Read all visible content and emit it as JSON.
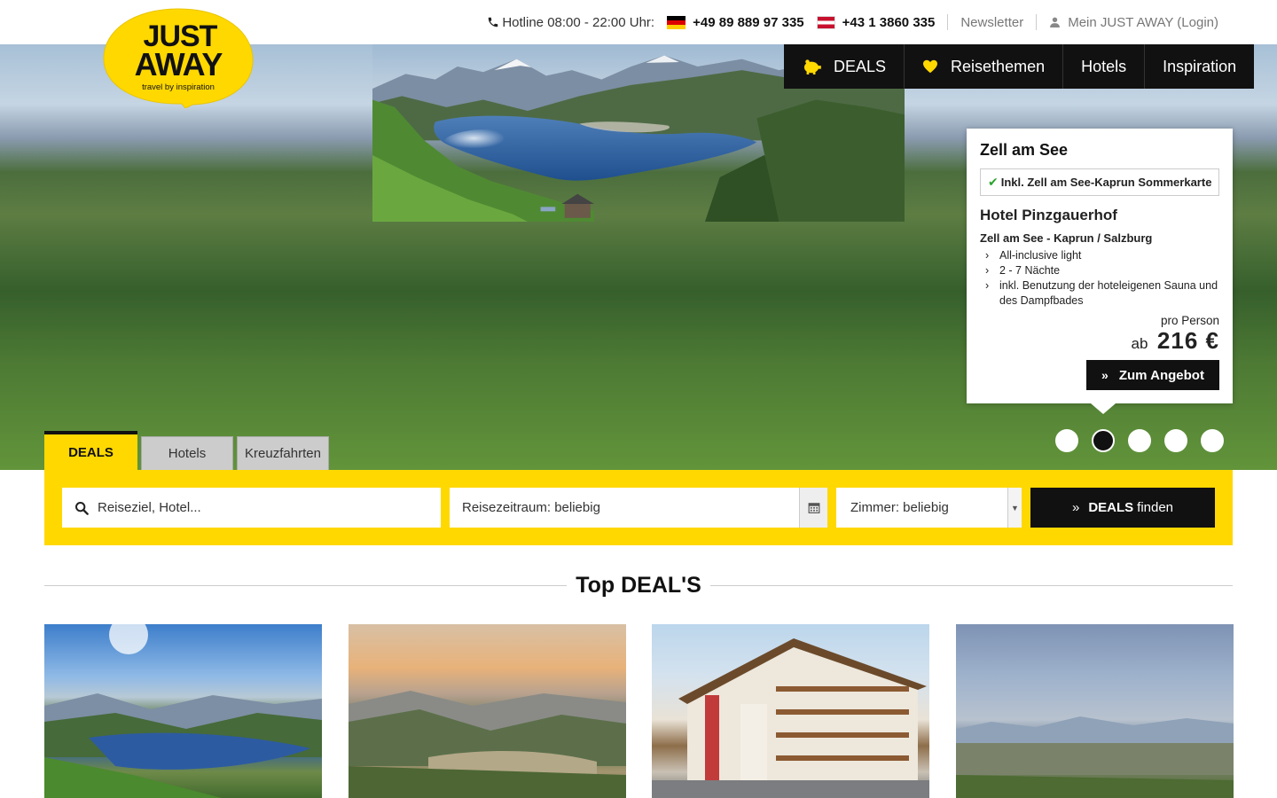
{
  "topbar": {
    "hotline_label": "Hotline 08:00 - 22:00 Uhr:",
    "phone_de": "+49 89 889 97 335",
    "phone_at": "+43 1 3860 335",
    "newsletter": "Newsletter",
    "login": "Mein JUST AWAY (Login)"
  },
  "logo": {
    "line1": "JUST",
    "line2": "AWAY",
    "tagline": "travel by inspiration"
  },
  "nav": [
    {
      "label": "DEALS",
      "icon": "piggy-bank-icon"
    },
    {
      "label": "Reisethemen",
      "icon": "heart-icon"
    },
    {
      "label": "Hotels"
    },
    {
      "label": "Inspiration"
    }
  ],
  "offer": {
    "title": "Zell am See",
    "badge": "Inkl. Zell am See-Kaprun Sommerkarte",
    "hotel": "Hotel Pinzgauerhof",
    "location": "Zell am See - Kaprun / Salzburg",
    "features": [
      "All-inclusive light",
      "2 - 7 Nächte",
      "inkl. Benutzung der hoteleigenen Sauna und des Dampfbades"
    ],
    "price_label": "pro Person",
    "price_prefix": "ab",
    "price": "216 €",
    "cta": "Zum Angebot"
  },
  "slider": {
    "count": 5,
    "active_index": 1
  },
  "search": {
    "tabs": [
      "DEALS",
      "Hotels",
      "Kreuzfahrten"
    ],
    "active_tab": 0,
    "destination_placeholder": "Reiseziel, Hotel...",
    "date_value": "Reisezeitraum: beliebig",
    "rooms_value": "Zimmer: beliebig",
    "button_bold": "DEALS",
    "button_rest": "finden"
  },
  "top_deals": {
    "title": "Top DEAL'S"
  },
  "colors": {
    "brand_yellow": "#ffd800",
    "dark": "#111111"
  }
}
